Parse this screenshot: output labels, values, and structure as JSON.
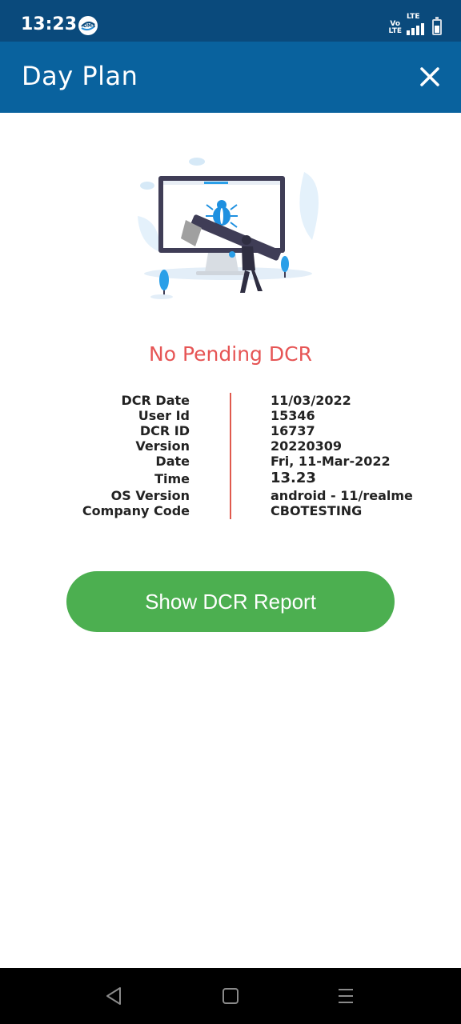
{
  "status_bar": {
    "time": "13:23",
    "app_icon": "dms-app-icon",
    "volte_line1": "Vo",
    "volte_line2": "LTE",
    "lte": "LTE",
    "icons": [
      "volte-icon",
      "signal-icon",
      "battery-icon"
    ],
    "battery_level": 0.5
  },
  "app_bar": {
    "title": "Day Plan",
    "close_icon": "close-icon"
  },
  "main": {
    "illustration": "bug-fix-illustration",
    "headline": "No Pending DCR",
    "info_rows": [
      {
        "label": "DCR Date",
        "value": "11/03/2022"
      },
      {
        "label": "User Id",
        "value": "15346"
      },
      {
        "label": "DCR ID",
        "value": "16737"
      },
      {
        "label": "Version",
        "value": "20220309"
      },
      {
        "label": "Date",
        "value": "Fri, 11-Mar-2022"
      },
      {
        "label": "Time",
        "value": "13.23"
      },
      {
        "label": "OS Version",
        "value": "android - 11/realme"
      },
      {
        "label": "Company Code",
        "value": "CBOTESTING"
      }
    ],
    "report_button": "Show DCR Report"
  },
  "nav_bar": {
    "icons": [
      "back-icon",
      "home-icon",
      "recents-icon"
    ]
  },
  "colors": {
    "status_bar": "#0a4a7c",
    "app_bar": "#09629e",
    "headline": "#e65555",
    "divider": "#e05a4e",
    "button": "#4caf50"
  }
}
